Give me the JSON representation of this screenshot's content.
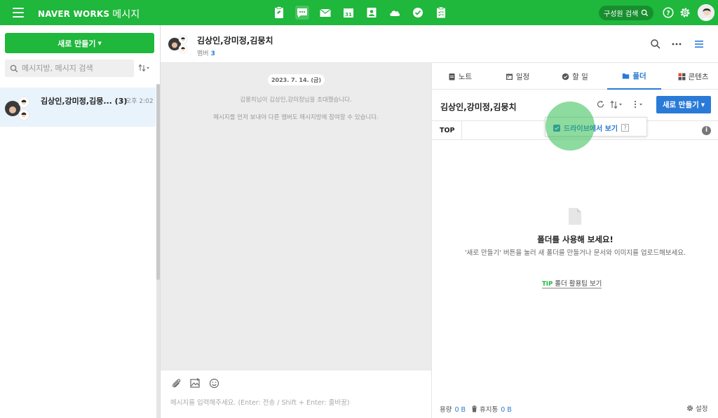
{
  "topbar": {
    "brand": "NAVER WORKS",
    "app_name": "메시지",
    "member_search_label": "구성원 검색",
    "app_icons": [
      "note-icon",
      "message-icon",
      "mail-icon",
      "calendar-icon",
      "contacts-icon",
      "drive-icon",
      "task-icon",
      "form-icon"
    ],
    "calendar_day": "31",
    "accent": "#1fb73c"
  },
  "left": {
    "new_button": "새로 만들기",
    "search_placeholder": "메시지방, 메시지 검색",
    "chats": [
      {
        "name": "김상인,강미정,김뭉... (3)",
        "time": "오후 2:02"
      }
    ]
  },
  "header": {
    "title": "김상인,강미정,김뭉치",
    "members_label": "멤버",
    "members_count": "3"
  },
  "chat": {
    "date": "2023. 7. 14. (금)",
    "system_messages": [
      "김뭉치님이 김상인,강미정님을 초대했습니다.",
      "메시지를 먼저 보내야 다른 멤버도 메시지방에 참여할 수 있습니다."
    ],
    "composer_placeholder": "메시지를 입력해주세요. (Enter: 전송 / Shift + Enter: 줄바꿈)"
  },
  "right": {
    "tabs": [
      {
        "label": "노트",
        "icon": "note-icon"
      },
      {
        "label": "일정",
        "icon": "calendar-icon"
      },
      {
        "label": "할 일",
        "icon": "check-icon"
      },
      {
        "label": "폴더",
        "icon": "folder-icon",
        "active": true
      },
      {
        "label": "콘텐츠",
        "icon": "content-icon"
      }
    ],
    "folder_title": "김상인,강미정,김뭉치",
    "new_button": "새로 만들기",
    "breadcrumb_top": "TOP",
    "dropdown_item": "드라이브에서 보기",
    "dropdown_help": "?",
    "empty_title": "폴더를 사용해 보세요!",
    "empty_desc": "'새로 만들기' 버튼을 눌러 새 폴더를 만들거나 문서와 이미지를 업로드해보세요.",
    "tip_badge": "TIP",
    "tip_text": "폴더 활용팁 보기",
    "usage_label": "용량",
    "usage_value": "0 B",
    "trash_label": "휴지통",
    "trash_value": "0 B",
    "settings_label": "설정",
    "accent": "#2a7ad8"
  }
}
